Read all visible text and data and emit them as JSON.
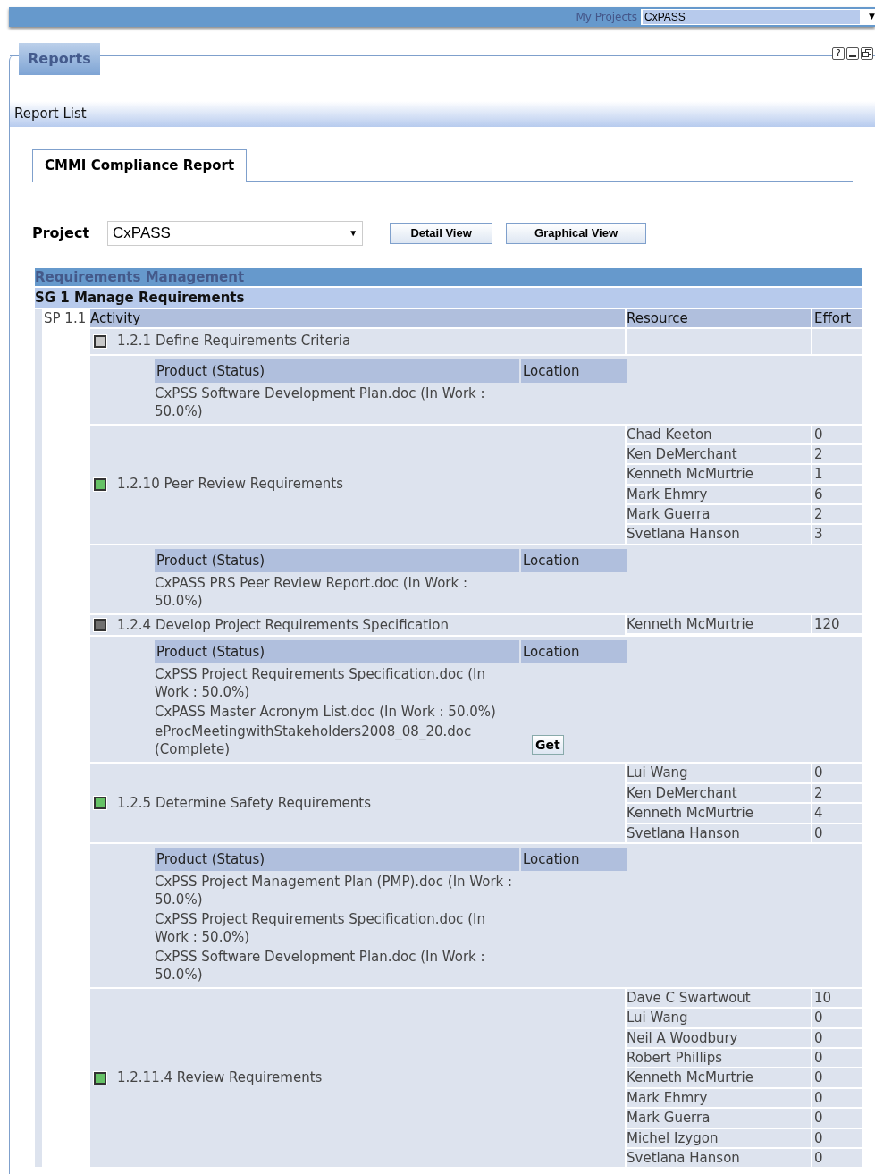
{
  "top_bar": {
    "label": "My Projects",
    "project": "CxPASS",
    "caret": "▼"
  },
  "panel": {
    "title": "Reports",
    "help": "?",
    "section": "Report List",
    "tab": "CMMI Compliance Report"
  },
  "filter": {
    "label": "Project",
    "value": "CxPASS",
    "caret": "▼",
    "buttons": [
      "Detail View",
      "Graphical View"
    ]
  },
  "report": {
    "area": "Requirements Management",
    "goal": "SG 1 Manage Requirements",
    "practice": "SP 1.1",
    "columns": [
      "Activity",
      "Resource",
      "Effort"
    ],
    "activities": [
      {
        "name": "1.2.1 Define Requirements Criteria",
        "color": "#c8c8c8",
        "product_columns": [
          "Product (Status)",
          "Location"
        ],
        "products": [
          {
            "text": "CxPSS Software Development Plan.doc (In Work : 50.0%)"
          }
        ]
      },
      {
        "name": "1.2.10 Peer Review Requirements",
        "color": "#66c266",
        "resources": [
          {
            "name": "Chad Keeton",
            "effort": "0"
          },
          {
            "name": "Ken DeMerchant",
            "effort": "2"
          },
          {
            "name": "Kenneth McMurtrie",
            "effort": "1"
          },
          {
            "name": "Mark Ehmry",
            "effort": "6"
          },
          {
            "name": "Mark Guerra",
            "effort": "2"
          },
          {
            "name": "Svetlana Hanson",
            "effort": "3"
          }
        ],
        "product_columns": [
          "Product (Status)",
          "Location"
        ],
        "products": [
          {
            "text": "CxPASS PRS Peer Review Report.doc (In Work : 50.0%)"
          }
        ]
      },
      {
        "name": "1.2.4 Develop Project Requirements Specification",
        "color": "#707070",
        "resources": [
          {
            "name": "Kenneth McMurtrie",
            "effort": "120"
          }
        ],
        "product_columns": [
          "Product (Status)",
          "Location"
        ],
        "products": [
          {
            "text": "CxPSS Project Requirements Specification.doc (In Work : 50.0%)"
          },
          {
            "text": "CxPASS Master Acronym List.doc (In Work : 50.0%)"
          },
          {
            "text": "eProcMeetingwithStakeholders2008_08_20.doc (Complete)",
            "action": "Get"
          }
        ]
      },
      {
        "name": "1.2.5 Determine Safety Requirements",
        "color": "#66c266",
        "resources": [
          {
            "name": "Lui Wang",
            "effort": "0"
          },
          {
            "name": "Ken DeMerchant",
            "effort": "2"
          },
          {
            "name": "Kenneth McMurtrie",
            "effort": "4"
          },
          {
            "name": "Svetlana Hanson",
            "effort": "0"
          }
        ],
        "product_columns": [
          "Product (Status)",
          "Location"
        ],
        "products": [
          {
            "text": "CxPSS Project Management Plan (PMP).doc (In Work : 50.0%)"
          },
          {
            "text": "CxPSS Project Requirements Specification.doc (In Work : 50.0%)"
          },
          {
            "text": "CxPSS Software Development Plan.doc (In Work : 50.0%)"
          }
        ]
      },
      {
        "name": "1.2.11.4 Review Requirements",
        "color": "#66c266",
        "resources": [
          {
            "name": "Dave C Swartwout",
            "effort": "10"
          },
          {
            "name": "Lui Wang",
            "effort": "0"
          },
          {
            "name": "Neil A Woodbury",
            "effort": "0"
          },
          {
            "name": "Robert Phillips",
            "effort": "0"
          },
          {
            "name": "Kenneth McMurtrie",
            "effort": "0"
          },
          {
            "name": "Mark Ehmry",
            "effort": "0"
          },
          {
            "name": "Mark Guerra",
            "effort": "0"
          },
          {
            "name": "Michel Izygon",
            "effort": "0"
          },
          {
            "name": "Svetlana Hanson",
            "effort": "0"
          }
        ]
      }
    ]
  }
}
